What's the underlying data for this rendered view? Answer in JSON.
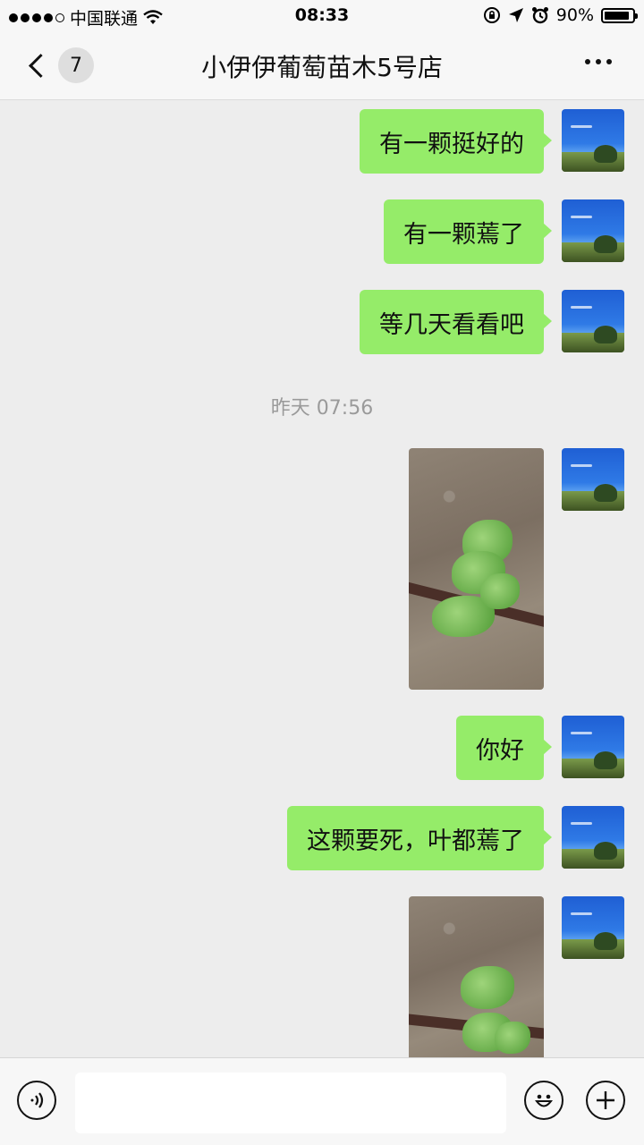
{
  "status_bar": {
    "carrier": "中国联通",
    "time": "08:33",
    "battery": "90%",
    "battery_level": 0.9
  },
  "nav": {
    "back_count": "7",
    "title": "小伊伊葡萄苗木5号店"
  },
  "messages": [
    {
      "type": "text",
      "text": "有一颗挺好的"
    },
    {
      "type": "text",
      "text": "有一颗蔫了"
    },
    {
      "type": "text",
      "text": "等几天看看吧"
    },
    {
      "type": "image",
      "subject": "grape-seedling-photo"
    },
    {
      "type": "text",
      "text": "你好"
    },
    {
      "type": "text",
      "text": "这颗要死，叶都蔫了"
    },
    {
      "type": "image",
      "subject": "grape-seedling-photo"
    }
  ],
  "timestamp": "昨天 07:56",
  "input_bar": {
    "placeholder": ""
  },
  "colors": {
    "bubble": "#95ec69",
    "background": "#ededed",
    "bar": "#f7f7f7"
  }
}
